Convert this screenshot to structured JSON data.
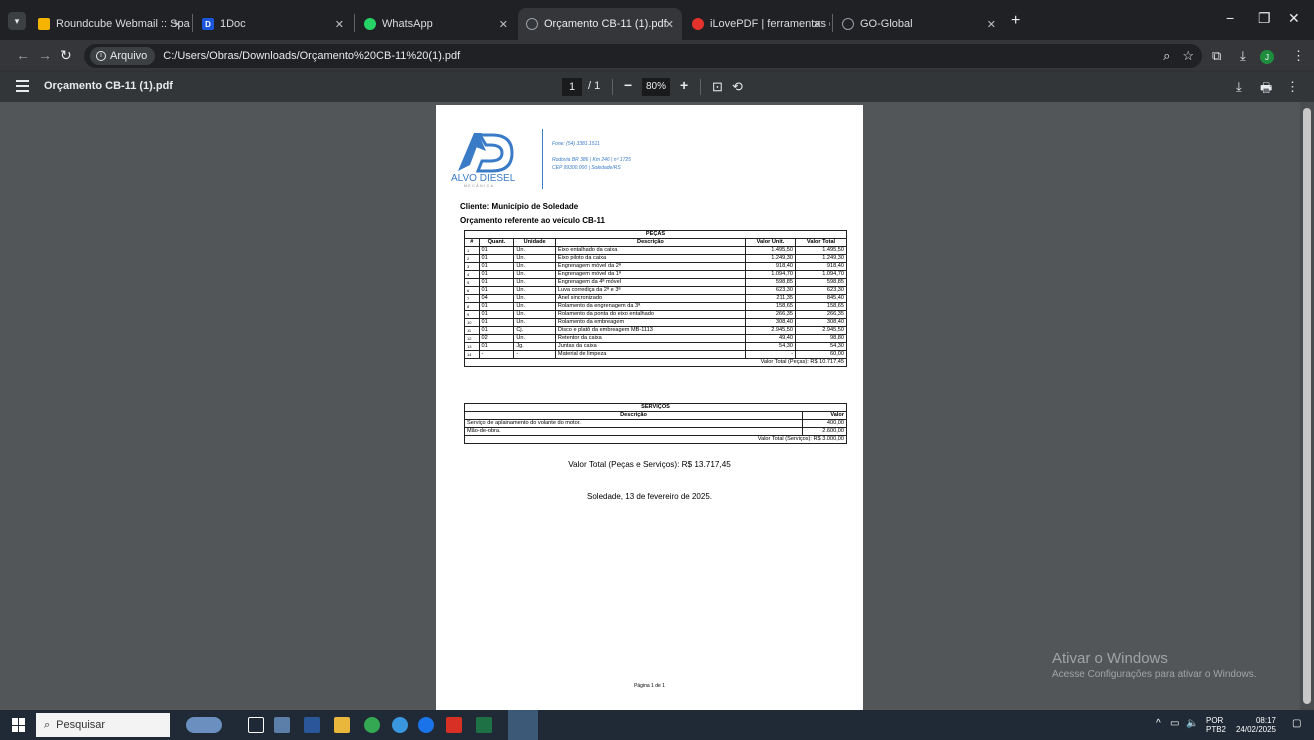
{
  "browser": {
    "tabs": [
      {
        "label": "Roundcube Webmail :: Spam",
        "icon": "roundcube-icon",
        "color": "#f4b400"
      },
      {
        "label": "1Doc",
        "icon": "1doc-icon",
        "color": "#1a56db"
      },
      {
        "label": "WhatsApp",
        "icon": "whatsapp-icon",
        "color": "#25d366"
      },
      {
        "label": "Orçamento CB-11 (1).pdf",
        "icon": "globe-icon",
        "color": "#9aa0a6"
      },
      {
        "label": "iLovePDF | ferramentas online p",
        "icon": "ilovepdf-icon",
        "color": "#e5322d"
      },
      {
        "label": "GO-Global",
        "icon": "globe-icon",
        "color": "#9aa0a6"
      }
    ],
    "omnibox": {
      "chip": "Arquivo",
      "url": "C:/Users/Obras/Downloads/Orçamento%20CB-11%20(1).pdf"
    },
    "profile_initial": "J"
  },
  "pdf_toolbar": {
    "title": "Orçamento CB-11 (1).pdf",
    "page_current": "1",
    "page_total": "/ 1",
    "zoom": "80%"
  },
  "document": {
    "contact": {
      "phone": "Fone: (54) 3381.1511",
      "address": "Rodovia BR 386 | Km 246 | nº 1725",
      "cep": "CEP 99300.000 | Soledade/RS"
    },
    "logo": {
      "name": "ALVO DIESEL",
      "sub": "MECÂNICA"
    },
    "cliente": "Cliente: Município de Soledade",
    "orcamento": "Orçamento referente ao veículo CB-11",
    "pecas": {
      "title": "PEÇAS",
      "headers": [
        "#",
        "Quant.",
        "Unidade",
        "Descrição",
        "Valor Unit.",
        "Valor Total"
      ],
      "rows": [
        [
          "1",
          "01",
          "Un.",
          "Eixo entalhado da caixa",
          "1.495,50",
          "1.495,50"
        ],
        [
          "2",
          "01",
          "Un.",
          "Eixo piloto da caixa",
          "1.249,30",
          "1.249,30"
        ],
        [
          "3",
          "01",
          "Un.",
          "Engrenagem móvel da 2ª",
          "918,40",
          "918,40"
        ],
        [
          "4",
          "01",
          "Un.",
          "Engrenagem móvel da 1ª",
          "1.094,70",
          "1.094,70"
        ],
        [
          "5",
          "01",
          "Un.",
          "Engrenagem da 4ª móvel",
          "598,85",
          "598,85"
        ],
        [
          "6",
          "01",
          "Un.",
          "Luva corrediça da 2ª e 3ª",
          "623,30",
          "623,30"
        ],
        [
          "7",
          "04",
          "Un.",
          "Anel sincronizado",
          "211,35",
          "845,40"
        ],
        [
          "8",
          "01",
          "Un.",
          "Rolamento da engrenagem da 3ª",
          "158,65",
          "158,65"
        ],
        [
          "9",
          "01",
          "Un.",
          "Rolamento da ponta do eixo entalhado",
          "266,35",
          "266,35"
        ],
        [
          "10",
          "01",
          "Un.",
          "Rolamento da embreagem",
          "308,40",
          "308,40"
        ],
        [
          "11",
          "01",
          "Cj.",
          "Disco e platô da embreagem MB-1113",
          "2.945,50",
          "2.945,50"
        ],
        [
          "12",
          "02",
          "Un.",
          "Retentor da caixa",
          "49,40",
          "98,80"
        ],
        [
          "13",
          "01",
          "Jg.",
          "Juntas da caixa",
          "54,30",
          "54,30"
        ],
        [
          "14",
          "-",
          "-",
          "Material de limpeza",
          "-",
          "60,00"
        ]
      ],
      "total": "Valor Total (Peças): R$ 10.717,45"
    },
    "servicos": {
      "title": "SERVIÇOS",
      "headers": [
        "Descrição",
        "Valor"
      ],
      "rows": [
        [
          "Serviço de aplainamento do volante do motor.",
          "400,00"
        ],
        [
          "Mão-de-obra.",
          "2.600,00"
        ]
      ],
      "total": "Valor Total (Serviços): R$ 3.000,00"
    },
    "total_geral": "Valor Total (Peças e Serviços): R$ 13.717,45",
    "local_data": "Soledade, 13 de fevereiro de 2025.",
    "page_footer": "Página 1 de 1"
  },
  "watermark": {
    "line1": "Ativar o Windows",
    "line2": "Acesse Configurações para ativar o Windows."
  },
  "taskbar": {
    "search_placeholder": "Pesquisar",
    "lang1": "POR",
    "lang2": "PTB2",
    "time": "08:17",
    "date": "24/02/2025"
  }
}
